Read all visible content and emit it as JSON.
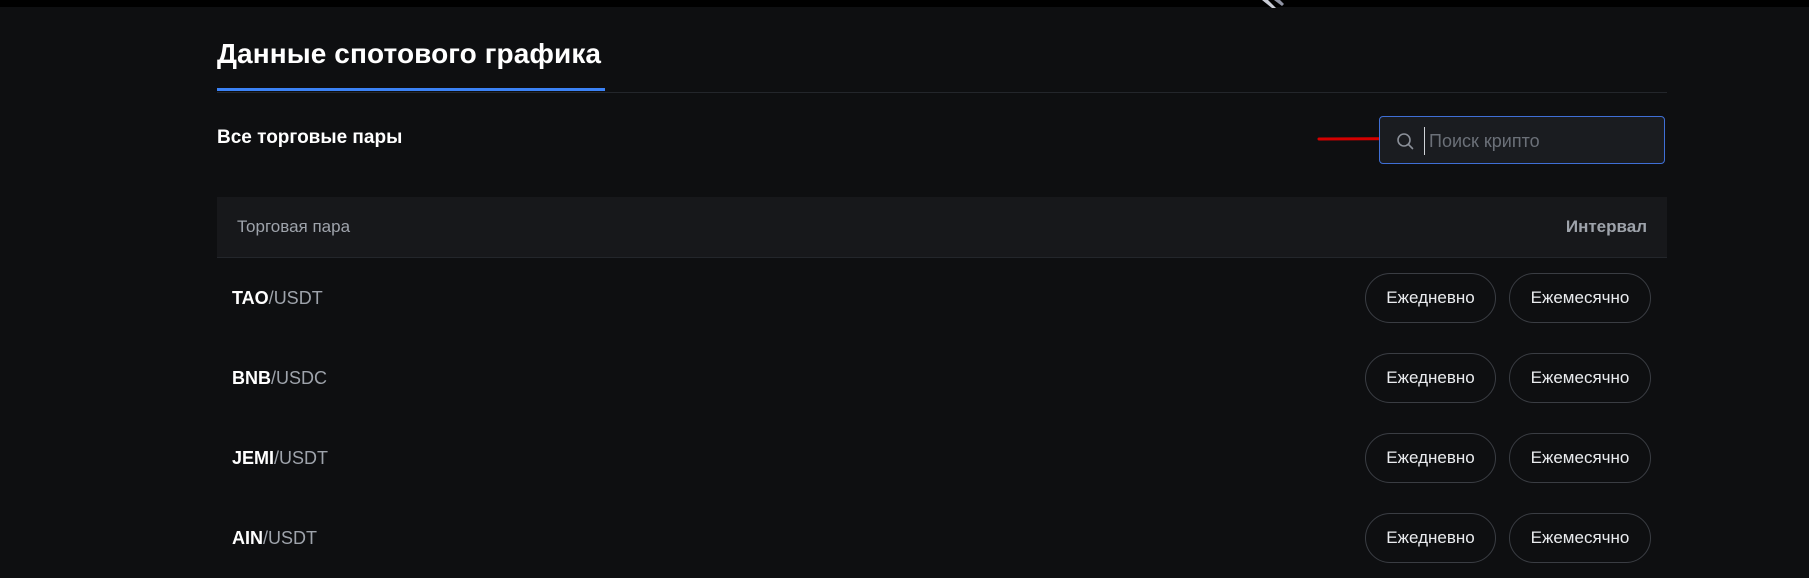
{
  "header": {
    "tab_title": "Данные спотового графика"
  },
  "section": {
    "title": "Все торговые пары"
  },
  "search": {
    "placeholder": "Поиск крипто",
    "value": "",
    "icon": "search-icon"
  },
  "table": {
    "columns": {
      "pair": "Торговая пара",
      "interval": "Интервал"
    },
    "rows": [
      {
        "base": "TAO",
        "separator": "/",
        "quote": "USDT",
        "daily_label": "Ежедневно",
        "monthly_label": "Ежемесячно"
      },
      {
        "base": "BNB",
        "separator": "/",
        "quote": "USDC",
        "daily_label": "Ежедневно",
        "monthly_label": "Ежемесячно"
      },
      {
        "base": "JEMI",
        "separator": "/",
        "quote": "USDT",
        "daily_label": "Ежедневно",
        "monthly_label": "Ежемесячно"
      },
      {
        "base": "AIN",
        "separator": "/",
        "quote": "USDT",
        "daily_label": "Ежедневно",
        "monthly_label": "Ежемесячно"
      }
    ]
  },
  "colors": {
    "background": "#0e0f11",
    "accent": "#3b82f6",
    "annotation_arrow": "#d40000"
  }
}
